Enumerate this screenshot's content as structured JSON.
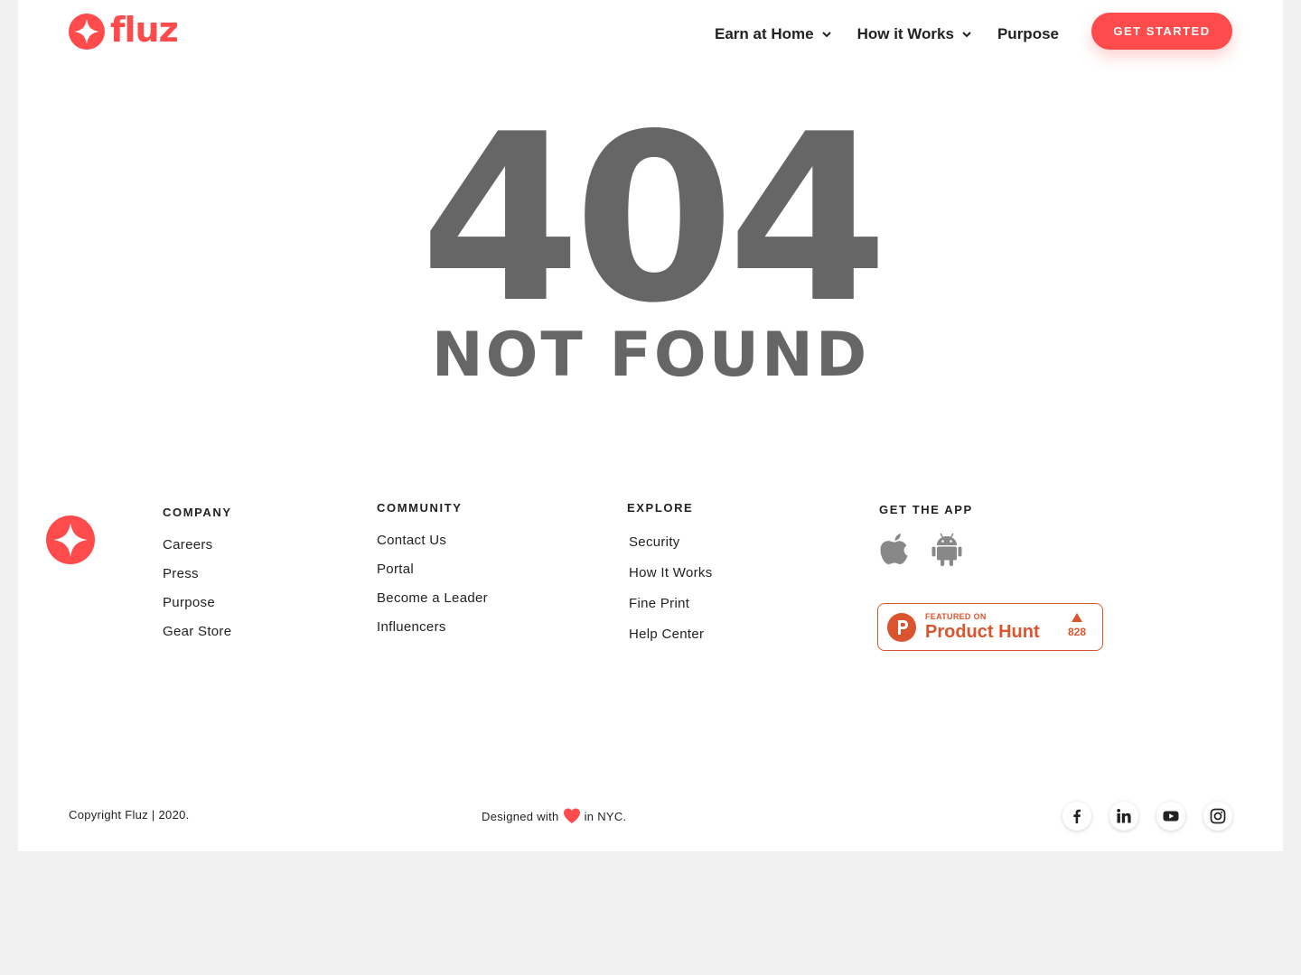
{
  "brand": {
    "name": "fluz",
    "color": "#ff4b4b"
  },
  "nav": {
    "items": [
      {
        "label": "Earn at Home",
        "has_dropdown": true
      },
      {
        "label": "How it Works",
        "has_dropdown": true
      },
      {
        "label": "Purpose",
        "has_dropdown": false
      }
    ],
    "cta_label": "GET STARTED"
  },
  "error": {
    "code": "404",
    "message": "NOT FOUND"
  },
  "footer": {
    "company": {
      "heading": "COMPANY",
      "links": [
        "Careers",
        "Press",
        "Purpose",
        "Gear Store"
      ]
    },
    "community": {
      "heading": "COMMUNITY",
      "links": [
        "Contact Us",
        "Portal",
        "Become a Leader",
        "Influencers"
      ]
    },
    "explore": {
      "heading": "EXPLORE",
      "links": [
        "Security",
        "How It Works",
        "Fine Print",
        "Help Center"
      ]
    },
    "app": {
      "heading": "GET THE APP",
      "icons": [
        "apple-icon",
        "android-icon"
      ]
    },
    "product_hunt": {
      "featured": "FEATURED ON",
      "name": "Product Hunt",
      "votes": "828",
      "color": "#da552f"
    },
    "copyright": "Copyright Fluz | 2020.",
    "designed_prefix": "Designed with",
    "designed_suffix": "in NYC.",
    "socials": [
      "facebook-icon",
      "linkedin-icon",
      "youtube-icon",
      "instagram-icon"
    ]
  }
}
